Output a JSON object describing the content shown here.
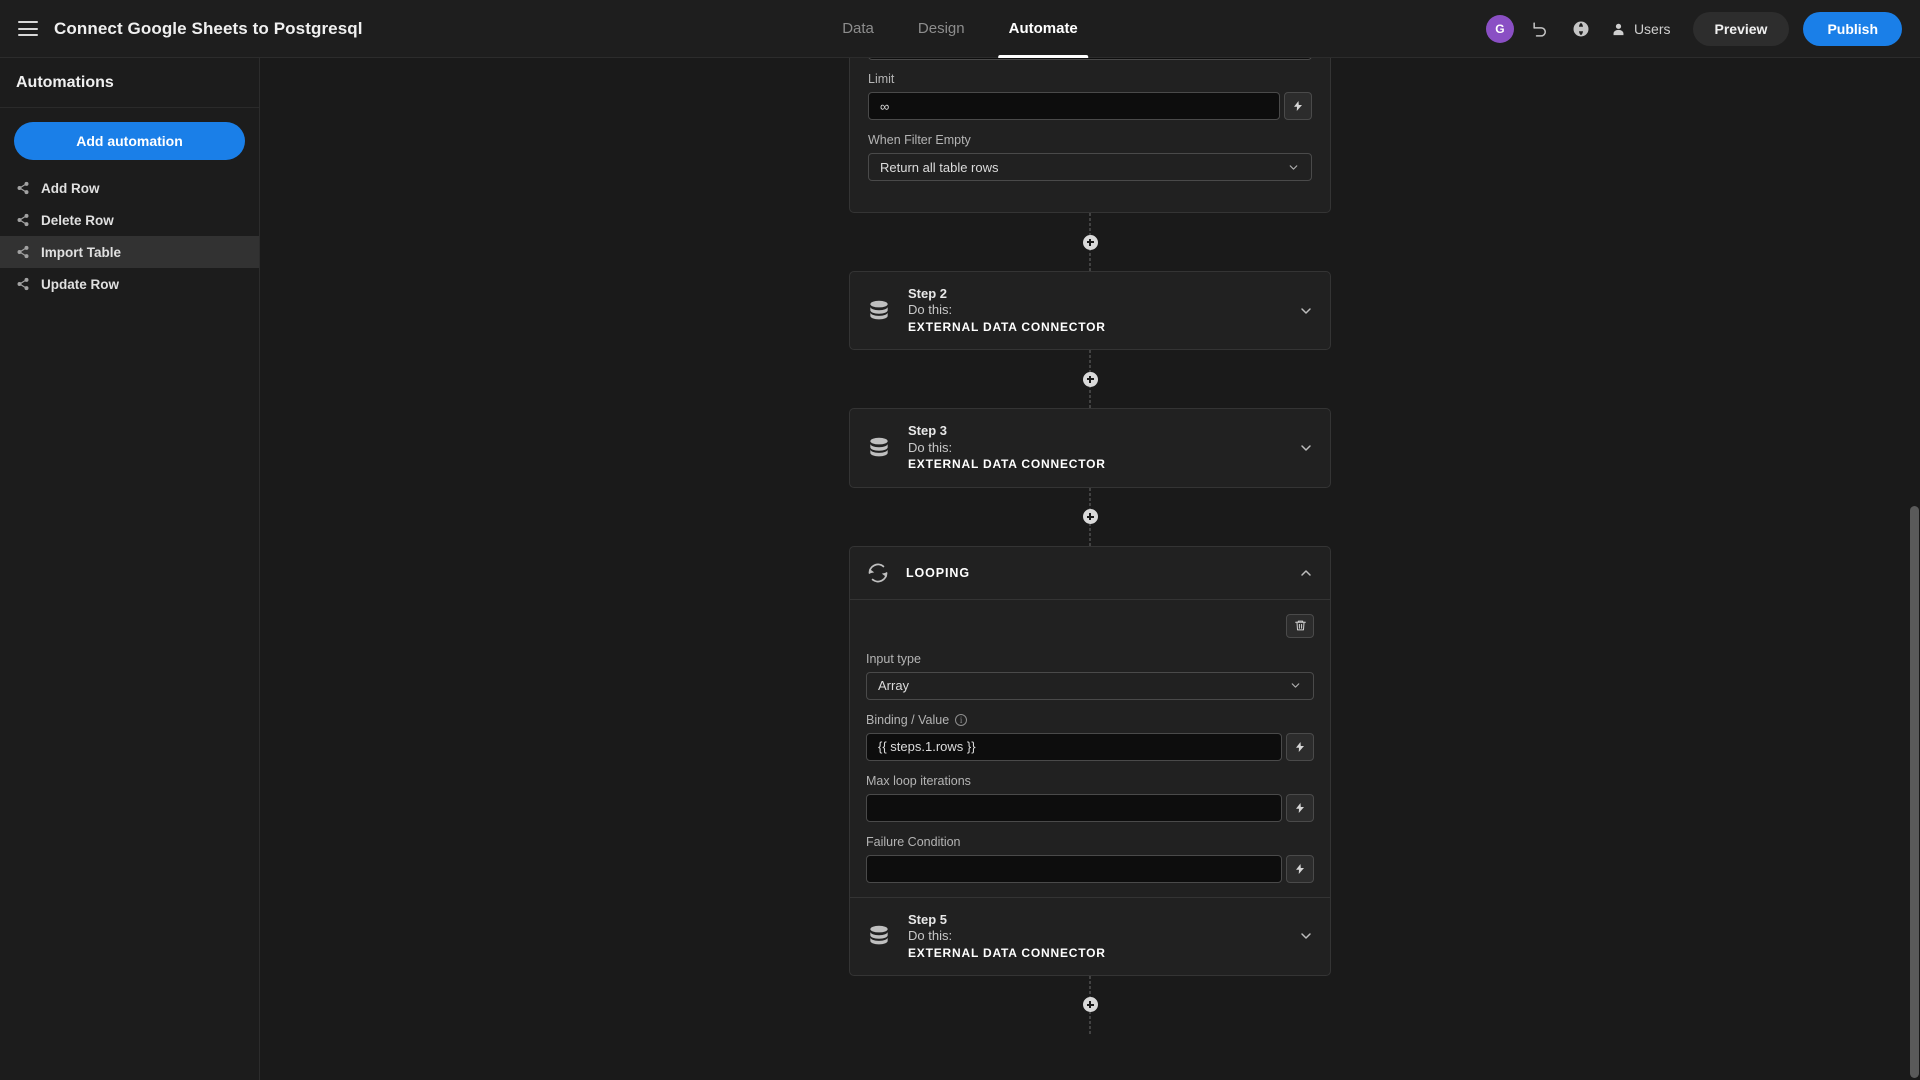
{
  "header": {
    "menu_icon": "hamburger-icon",
    "title": "Connect Google Sheets to Postgresql",
    "tabs": [
      {
        "label": "Data",
        "active": false
      },
      {
        "label": "Design",
        "active": false
      },
      {
        "label": "Automate",
        "active": true
      }
    ],
    "avatar_initial": "G",
    "undo_icon": "undo-icon",
    "globe_icon": "globe-icon",
    "users_icon": "users-icon",
    "users_label": "Users",
    "preview_label": "Preview",
    "publish_label": "Publish",
    "publish_color": "#1a7fe8"
  },
  "sidebar": {
    "heading": "Automations",
    "add_button_label": "Add automation",
    "items": [
      {
        "label": "Add Row",
        "icon": "share-nodes-icon",
        "selected": false
      },
      {
        "label": "Delete Row",
        "icon": "share-nodes-icon",
        "selected": false
      },
      {
        "label": "Import Table",
        "icon": "share-nodes-icon",
        "selected": true
      },
      {
        "label": "Update Row",
        "icon": "share-nodes-icon",
        "selected": false
      }
    ]
  },
  "flow": {
    "top_step_fields": {
      "limit_label": "Limit",
      "limit_value": "∞",
      "when_filter_empty_label": "When Filter Empty",
      "when_filter_empty_value": "Return all table rows"
    },
    "steps": [
      {
        "name": "Step 2",
        "do_label": "Do this:",
        "type": "EXTERNAL DATA CONNECTOR",
        "icon": "database-icon",
        "chevron": "chevron-down-icon"
      },
      {
        "name": "Step 3",
        "do_label": "Do this:",
        "type": "EXTERNAL DATA CONNECTOR",
        "icon": "database-icon",
        "chevron": "chevron-down-icon"
      }
    ],
    "looping": {
      "title": "LOOPING",
      "icon": "loop-icon",
      "chevron": "chevron-up-icon",
      "delete_icon": "trash-icon",
      "input_type_label": "Input type",
      "input_type_value": "Array",
      "binding_label": "Binding / Value",
      "binding_info_icon": "info-icon",
      "binding_value": "{{ steps.1.rows }}",
      "max_iterations_label": "Max loop iterations",
      "max_iterations_value": "",
      "failure_condition_label": "Failure Condition",
      "failure_condition_value": "",
      "binding_button_icon": "lightning-bolt-icon"
    },
    "last_step": {
      "name": "Step 5",
      "do_label": "Do this:",
      "type": "EXTERNAL DATA CONNECTOR",
      "icon": "database-icon",
      "chevron": "chevron-down-icon"
    },
    "add_step_icon": "plus-circle-icon"
  }
}
